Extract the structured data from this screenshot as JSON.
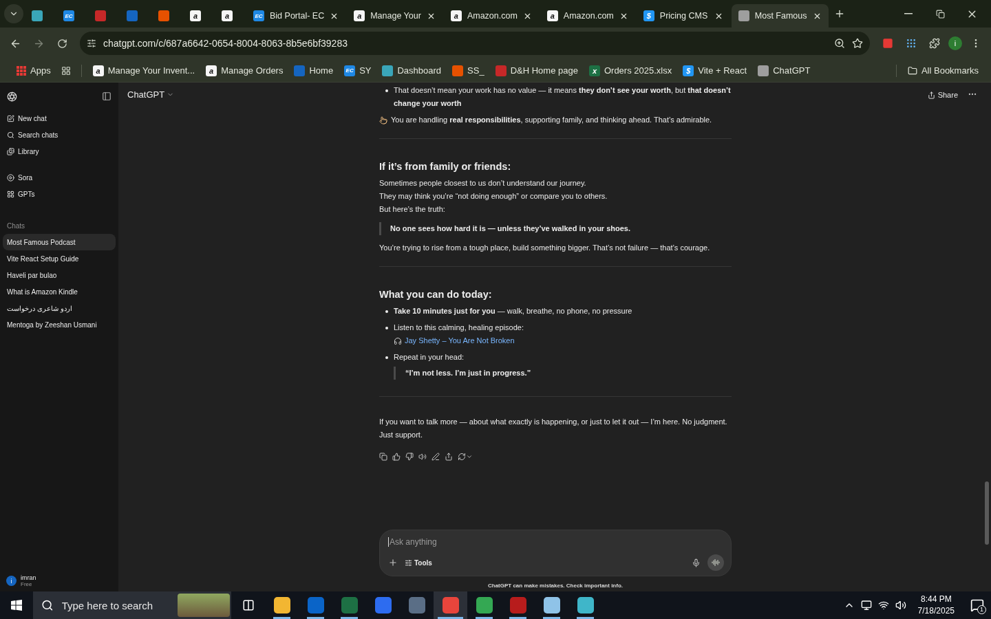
{
  "browser": {
    "tabs": [
      {
        "color": "#3aa6b9",
        "selected": false
      },
      {
        "color": "#1e88e5",
        "icon_text": "EC",
        "selected": false
      },
      {
        "color": "#c62828",
        "selected": false
      },
      {
        "color": "#1565c0",
        "selected": false
      },
      {
        "color": "#e65100",
        "selected": false
      },
      {
        "color": "#f5f5f5",
        "icon_text": "a",
        "selected": false
      },
      {
        "color": "#f5f5f5",
        "icon_text": "a",
        "selected": false
      },
      {
        "title": "Bid Portal- EC",
        "color": "#1e88e5",
        "icon_text": "EC",
        "selected": false
      },
      {
        "title": "Manage Your",
        "color": "#f5f5f5",
        "icon_text": "a",
        "selected": false
      },
      {
        "title": "Amazon.com",
        "color": "#f5f5f5",
        "icon_text": "a",
        "selected": false
      },
      {
        "title": "Amazon.com",
        "color": "#f5f5f5",
        "icon_text": "a",
        "selected": false
      },
      {
        "title": "Pricing CMS",
        "color": "#2196f3",
        "icon_text": "$",
        "selected": false
      },
      {
        "title": "Most Famous",
        "color": "#9e9e9e",
        "selected": true
      }
    ],
    "url": "chatgpt.com/c/687a6642-0654-8004-8063-8b5e6bf39283",
    "profile_initial": "i",
    "bookmarks": [
      {
        "label": "Apps",
        "color": "#e53935"
      },
      {
        "label": "Manage Your Invent...",
        "color": "#f5f5f5",
        "icon_text": "a"
      },
      {
        "label": "Manage Orders",
        "color": "#f5f5f5",
        "icon_text": "a"
      },
      {
        "label": "Home",
        "color": "#1565c0"
      },
      {
        "label": "SY",
        "color": "#1e88e5",
        "icon_text": "EC"
      },
      {
        "label": "Dashboard",
        "color": "#3aa6b9"
      },
      {
        "label": "SS_",
        "color": "#e65100"
      },
      {
        "label": "D&H Home page",
        "color": "#c62828"
      },
      {
        "label": "Orders 2025.xlsx",
        "color": "#1d7044",
        "icon_text": "x"
      },
      {
        "label": "Vite + React",
        "color": "#2196f3",
        "icon_text": "$"
      },
      {
        "label": "ChatGPT",
        "color": "#9e9e9e"
      }
    ],
    "all_bookmarks": "All Bookmarks"
  },
  "sidebar": {
    "nav": [
      {
        "label": "New chat",
        "kind": "new"
      },
      {
        "label": "Search chats",
        "kind": "search"
      },
      {
        "label": "Library",
        "kind": "library"
      }
    ],
    "apps": [
      {
        "label": "Sora",
        "kind": "sora"
      },
      {
        "label": "GPTs",
        "kind": "gpts"
      }
    ],
    "chats_heading": "Chats",
    "chats": [
      {
        "title": "Most Famous Podcast",
        "selected": true
      },
      {
        "title": "Vite React Setup Guide",
        "selected": false
      },
      {
        "title": "Haveli par bulao",
        "selected": false
      },
      {
        "title": "What is Amazon Kindle",
        "selected": false
      },
      {
        "title": "اردو شاعری درخواست",
        "selected": false
      },
      {
        "title": "Mentoga by Zeeshan Usmani",
        "selected": false
      }
    ],
    "user": {
      "initial": "i",
      "name": "imran",
      "plan": "Free"
    }
  },
  "header": {
    "model": "ChatGPT",
    "share": "Share"
  },
  "content": [
    {
      "kind": "bullet",
      "text": "That doesn’t mean your work has no value — it means **they don’t see your worth**, but **that doesn’t change your worth**"
    },
    {
      "kind": "note",
      "text": "You are handling **real responsibilities**, supporting family, and thinking ahead. That’s admirable."
    },
    {
      "kind": "divider"
    },
    {
      "kind": "heading",
      "text": "If it’s from family or friends:"
    },
    {
      "kind": "lines",
      "lines": [
        "Sometimes people closest to us don’t understand our journey.",
        "They may think you’re “not doing enough” or compare you to others.",
        "But here’s the truth:"
      ]
    },
    {
      "kind": "quote",
      "text": "No one sees how hard it is — unless they’ve walked in your shoes."
    },
    {
      "kind": "paragraph",
      "text": "You’re trying to rise from a tough place, build something bigger. That’s not failure — that’s courage."
    },
    {
      "kind": "divider"
    },
    {
      "kind": "heading",
      "text": "What you can do today:"
    },
    {
      "kind": "bullet",
      "text": "**Take 10 minutes just for you** — walk, breathe, no phone, no pressure"
    },
    {
      "kind": "bullet",
      "text": "Listen to this calming, healing episode:",
      "link": "Jay Shetty – You Are Not Broken"
    },
    {
      "kind": "bullet",
      "text": "Repeat in your head:",
      "quote": "“I’m not less. I’m just in progress.”"
    },
    {
      "kind": "divider"
    },
    {
      "kind": "paragraph",
      "text": "If you want to talk more — about what exactly is happening, or just to let it out — I’m here. No judgment. Just support."
    }
  ],
  "composer": {
    "placeholder": "Ask anything",
    "tools": "Tools",
    "disclaimer": "ChatGPT can make mistakes. Check important info."
  },
  "taskbar": {
    "search_placeholder": "Type here to search",
    "apps": [
      {
        "color": "#f2b632",
        "running": true,
        "selected": false
      },
      {
        "color": "#0a64c8",
        "running": true,
        "selected": false
      },
      {
        "color": "#1d7044",
        "running": true,
        "selected": false
      },
      {
        "color": "#2d6cf0",
        "running": false,
        "selected": false
      },
      {
        "color": "#5a6e86",
        "running": false,
        "selected": false
      },
      {
        "color": "#e8453c",
        "running": true,
        "selected": true
      },
      {
        "color": "#34a853",
        "running": true,
        "selected": false
      },
      {
        "color": "#b71c1c",
        "running": true,
        "selected": false
      },
      {
        "color": "#8fc3e8",
        "running": true,
        "selected": false
      },
      {
        "color": "#3fb6c9",
        "running": true,
        "selected": false
      }
    ],
    "time": "8:44 PM",
    "date": "7/18/2025",
    "notifications": "1"
  }
}
